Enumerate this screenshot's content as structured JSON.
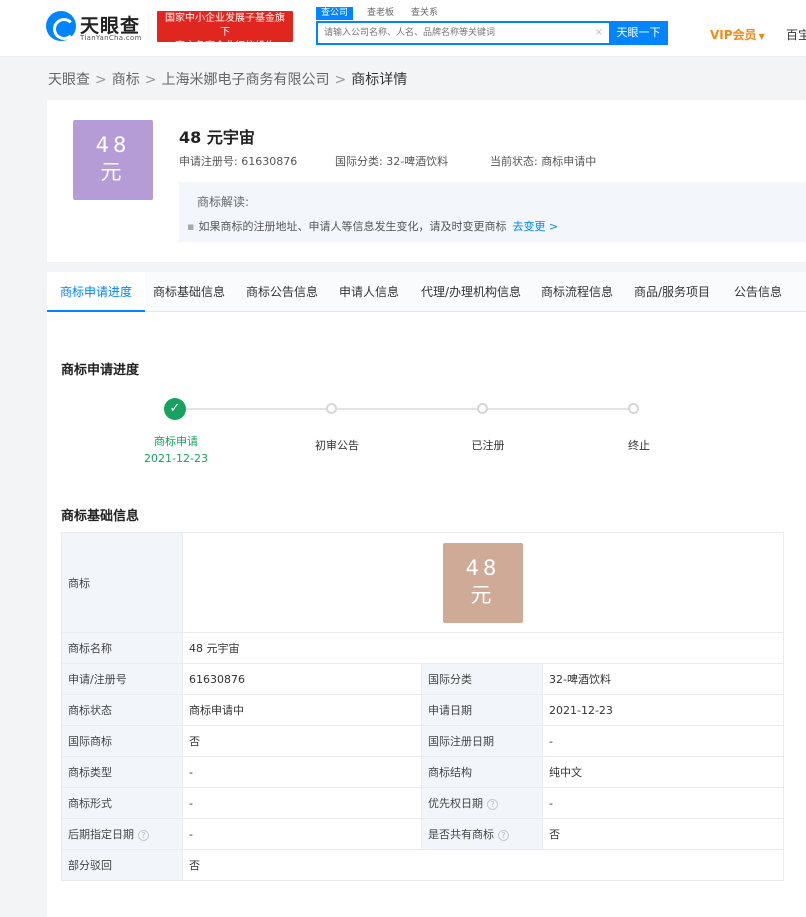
{
  "header": {
    "logo_text": "天眼查",
    "logo_sub": "TianYanCha.com",
    "badge_line1": "国家中小企业发展子基金旗下",
    "badge_line2": "官方备案企业征信机构",
    "search_tabs": [
      "查公司",
      "查老板",
      "查关系"
    ],
    "search_placeholder": "请输入公司名称、人名、品牌名称等关键词",
    "search_clear": "×",
    "search_button": "天眼一下",
    "vip": "VIP会员",
    "vip_caret": "▼",
    "baijia": "百宝"
  },
  "breadcrumb": {
    "items": [
      "天眼查",
      "商标",
      "上海米娜电子商务有限公司"
    ],
    "current": "商标详情",
    "sep": ">"
  },
  "trademark": {
    "image_line1": "48",
    "image_line2": "元",
    "title": "48 元宇宙",
    "reg_no_label": "申请注册号:",
    "reg_no": "61630876",
    "class_label": "国际分类:",
    "class_value": "32-啤酒饮料",
    "status_label": "当前状态:",
    "status_value": "商标申请中",
    "colors": {
      "purple": "#b59cd6",
      "tan": "#cfaa96"
    }
  },
  "interpretation": {
    "title": "商标解读:",
    "text": "如果商标的注册地址、申请人等信息发生变化，请及时变更商标",
    "link": "去变更 >"
  },
  "tabs": [
    "商标申请进度",
    "商标基础信息",
    "商标公告信息",
    "申请人信息",
    "代理/办理机构信息",
    "商标流程信息",
    "商品/服务项目",
    "公告信息"
  ],
  "progress": {
    "title": "商标申请进度",
    "steps": [
      {
        "label": "商标申请",
        "date": "2021-12-23",
        "done": true
      },
      {
        "label": "初审公告",
        "done": false
      },
      {
        "label": "已注册",
        "done": false
      },
      {
        "label": "终止",
        "done": false
      }
    ],
    "check": "✓",
    "done_color": "#19a15f"
  },
  "basic_info": {
    "title": "商标基础信息",
    "trademark_label": "商标",
    "rows": [
      {
        "l1": "商标名称",
        "v1": "48 元宇宙"
      },
      {
        "l1": "申请/注册号",
        "v1": "61630876",
        "l2": "国际分类",
        "v2": "32-啤酒饮料"
      },
      {
        "l1": "商标状态",
        "v1": "商标申请中",
        "l2": "申请日期",
        "v2": "2021-12-23"
      },
      {
        "l1": "国际商标",
        "v1": "否",
        "l2": "国际注册日期",
        "v2": "-"
      },
      {
        "l1": "商标类型",
        "v1": "-",
        "l2": "商标结构",
        "v2": "纯中文"
      },
      {
        "l1": "商标形式",
        "v1": "-",
        "l2": "优先权日期",
        "v2": "-"
      },
      {
        "l1": "后期指定日期",
        "v1": "-",
        "l2": "是否共有商标",
        "v2": "否"
      },
      {
        "l1": "部分驳回",
        "v1": "否"
      }
    ],
    "help_icon": "?"
  }
}
